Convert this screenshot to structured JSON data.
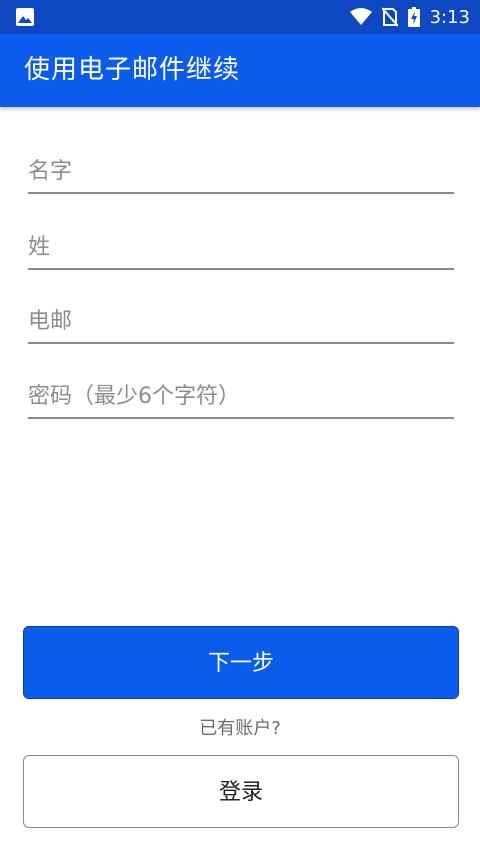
{
  "status_bar": {
    "time": "3:13",
    "icons": [
      "image-icon",
      "wifi-icon",
      "no-sim-icon",
      "battery-charging-icon"
    ]
  },
  "app_bar": {
    "title": "使用电子邮件继续"
  },
  "form": {
    "first_name_placeholder": "名字",
    "last_name_placeholder": "姓",
    "email_placeholder": "电邮",
    "password_placeholder": "密码（最少6个字符）"
  },
  "actions": {
    "next_label": "下一步",
    "have_account_text": "已有账户?",
    "login_label": "登录"
  },
  "colors": {
    "primary": "#0b5ced",
    "status_bar": "#0d47c2"
  }
}
